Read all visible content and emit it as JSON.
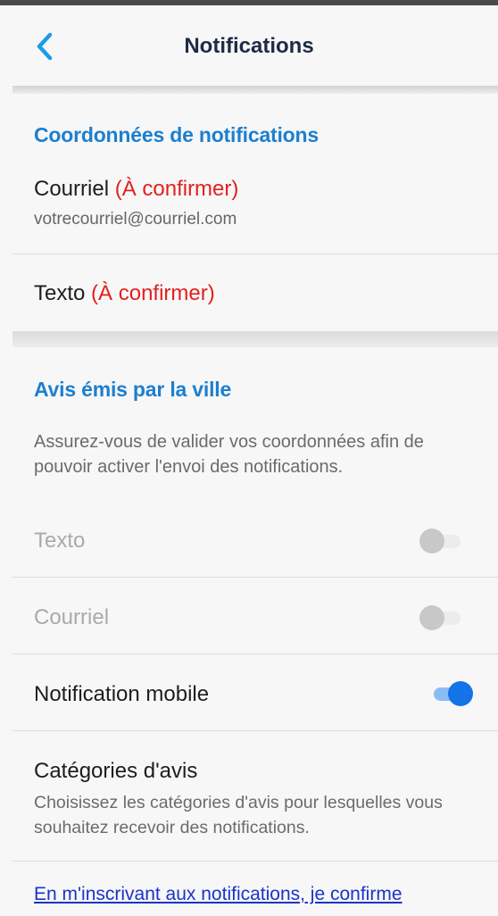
{
  "header": {
    "title": "Notifications",
    "back_icon": "chevron-left-icon"
  },
  "contact": {
    "section_title": "Coordonnées de notifications",
    "email": {
      "label": "Courriel",
      "status": "(À confirmer)",
      "value": "votrecourriel@courriel.com"
    },
    "sms": {
      "label": "Texto",
      "status": "(À confirmer)"
    }
  },
  "city": {
    "section_title": "Avis émis par la ville",
    "description": "Assurez-vous de valider vos coordonnées afin de pouvoir activer l'envoi des notifications.",
    "toggles": [
      {
        "label": "Texto",
        "enabled": false,
        "checked": false
      },
      {
        "label": "Courriel",
        "enabled": false,
        "checked": false
      },
      {
        "label": "Notification mobile",
        "enabled": true,
        "checked": true
      }
    ],
    "categories": {
      "label": "Catégories d'avis",
      "description": "Choisissez les catégories d'avis pour lesquelles vous souhaitez recevoir des notifications."
    }
  },
  "legal_link": "En m'inscrivant aux notifications, je confirme",
  "colors": {
    "accent": "#1c7fd0",
    "warning": "#e3201f",
    "toggle_on": "#1473e6",
    "link": "#1a34c9"
  }
}
